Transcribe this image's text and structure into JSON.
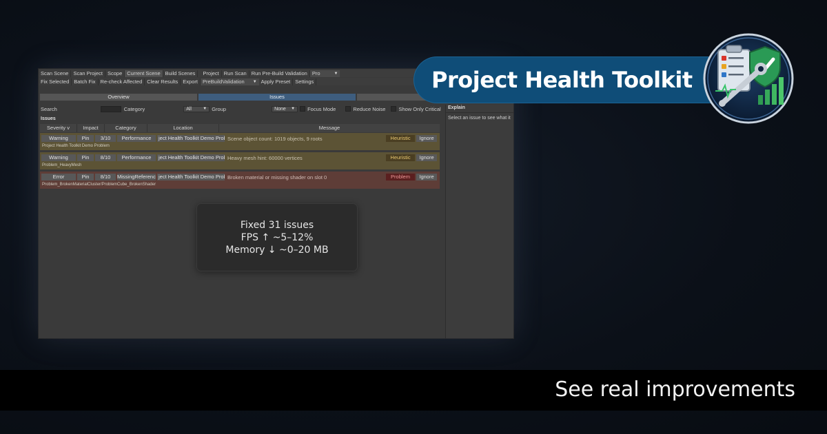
{
  "toolbar_row1": {
    "scan_scene": "Scan Scene",
    "scan_project": "Scan Project",
    "scope": "Scope",
    "current_scene": "Current Scene",
    "build_scenes": "Build Scenes",
    "project": "Project",
    "run_scan": "Run Scan",
    "run_prebuild": "Run Pre-Build Validation",
    "tier_value": "Pro"
  },
  "toolbar_row2": {
    "fix_selected": "Fix Selected",
    "batch_fix": "Batch Fix",
    "recheck": "Re-check Affected",
    "clear_results": "Clear Results",
    "export": "Export",
    "preset_value": "PreBuildValidation",
    "apply_preset": "Apply Preset",
    "settings": "Settings"
  },
  "tabs": {
    "overview": "Overview",
    "issues": "Issues",
    "third": ""
  },
  "filters": {
    "search_label": "Search",
    "search_value": "",
    "category_label": "Category",
    "category_value": "All",
    "group_label": "Group",
    "group_value": "None",
    "focus_mode": "Focus Mode",
    "reduce_noise": "Reduce Noise",
    "show_only_critical": "Show Only Critical"
  },
  "issues_section": {
    "title": "Issues",
    "columns": {
      "severity": "Severity v",
      "impact": "Impact",
      "category": "Category",
      "location": "Location",
      "message": "Message"
    },
    "rows": [
      {
        "severity": "Warning",
        "pin": "Pin",
        "impact": "3/10",
        "category": "Performance",
        "location": "ject Health Toolkit Demo Prob",
        "message": "Scene object count: 1019 objects, 9 roots",
        "tag": "Heuristic",
        "ignore": "Ignore",
        "path": "Project Health Toolkit Demo Problem"
      },
      {
        "severity": "Warning",
        "pin": "Pin",
        "impact": "8/10",
        "category": "Performance",
        "location": "ject Health Toolkit Demo Prob",
        "message": "Heavy mesh hint: 60000 vertices",
        "tag": "Heuristic",
        "ignore": "Ignore",
        "path": "Problem_HeavyMesh"
      },
      {
        "severity": "Error",
        "pin": "Pin",
        "impact": "8/10",
        "category": "MissingReference",
        "location": "ject Health Toolkit Demo Prob",
        "message": "Broken material or missing shader on slot 0",
        "tag": "Problem",
        "ignore": "Ignore",
        "path": "Problem_BrokenMaterialCluster/ProblemCube_BrokenShader"
      }
    ]
  },
  "explain_panel": {
    "title": "Explain",
    "hint": "Select an issue to see what it"
  },
  "toast": {
    "line1": "Fixed 31 issues",
    "line2": "FPS ↑ ~5–12%",
    "line3": "Memory ↓ ~0–20 MB"
  },
  "banner": {
    "title": "Project Health Toolkit"
  },
  "footer": {
    "tagline": "See real improvements"
  },
  "colors": {
    "banner_blue": "#0f4d78",
    "active_tab": "#3e5d7e",
    "warning_row": "#5c5335",
    "error_row": "#5e3d37",
    "heuristic_tag": "#e8c770",
    "problem_tag": "#f09a9a"
  },
  "icons": {
    "logo": "clipboard-shield-wrench-chart-icon"
  }
}
